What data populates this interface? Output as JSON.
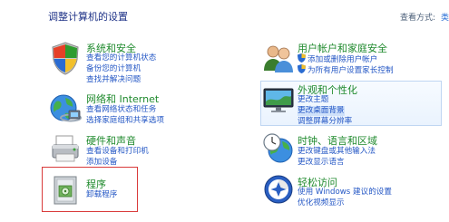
{
  "header": {
    "title": "调整计算机的设置",
    "view_by_label": "查看方式:",
    "view_by_value": "类"
  },
  "categories": [
    {
      "title": "系统和安全",
      "icon": "shield-flag-icon",
      "links": [
        "查看您的计算机状态",
        "备份您的计算机",
        "查找并解决问题"
      ]
    },
    {
      "title": "网络和 Internet",
      "icon": "globe-network-icon",
      "links": [
        "查看网络状态和任务",
        "选择家庭组和共享选项"
      ]
    },
    {
      "title": "硬件和声音",
      "icon": "printer-icon",
      "links": [
        "查看设备和打印机",
        "添加设备"
      ]
    },
    {
      "title": "程序",
      "icon": "programs-icon",
      "links": [
        "卸载程序"
      ]
    },
    {
      "title": "用户帐户和家庭安全",
      "icon": "users-icon",
      "links": [
        "添加或删除用户帐户",
        "为所有用户设置家长控制"
      ]
    },
    {
      "title": "外观和个性化",
      "icon": "display-icon",
      "links": [
        "更改主题",
        "更改桌面背景",
        "调整屏幕分辨率"
      ]
    },
    {
      "title": "时钟、语言和区域",
      "icon": "clock-globe-icon",
      "links": [
        "更改键盘或其他输入法",
        "更改显示语言"
      ]
    },
    {
      "title": "轻松访问",
      "icon": "ease-of-access-icon",
      "links": [
        "使用 Windows 建议的设置",
        "优化视频显示"
      ]
    }
  ],
  "colors": {
    "title_blue": "#1e3287",
    "category_green": "#1f8a2d",
    "link_blue": "#2457c5",
    "highlight_red": "#d93a3a"
  }
}
